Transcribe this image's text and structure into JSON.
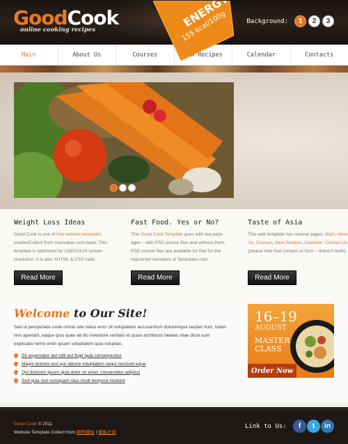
{
  "logo": {
    "part1": "Good",
    "part2": "Cook",
    "tagline": "online cooking recipes"
  },
  "background_switch": {
    "label": "Background:",
    "options": [
      "1",
      "2",
      "3"
    ],
    "active": "1"
  },
  "nav": {
    "items": [
      "Main",
      "About Us",
      "Courses",
      "New Recipes",
      "Calendar",
      "Contacts"
    ],
    "active": "Main"
  },
  "slider": {
    "badge_line1": "ENERGY",
    "badge_line2": "155 kcal/100g",
    "slide_count": 3,
    "current_slide": 1
  },
  "columns": [
    {
      "title": "Weight Loss Ideas",
      "text_pre": "Good Cook is one of ",
      "text_link": "free website templates",
      "text_post": " createdCollect from cssmoban.com team. This template is optimized for 1280X1024 screen resolution. It is also XHTML & CSS valid.",
      "button": "Read More"
    },
    {
      "title": "Fast Food. Yes or No?",
      "text_pre": "This ",
      "text_link": "Good Cook Template",
      "text_post": " goes with two pack ages – with PSD source files and without them. PSD source files are available for free for the registered members of Templates.com.",
      "button": "Read More"
    },
    {
      "title": "Taste of Asia",
      "text_pre": "This web template has several pages: ",
      "links": [
        "Main",
        "About Us",
        "Courses",
        "New Recipes",
        "Calendar",
        "Contact Us"
      ],
      "text_post": " (please note that contact us form – doesn't work).",
      "button": "Read More"
    }
  ],
  "welcome": {
    "title_part1": "Welcome",
    "title_part2": " to Our Site!",
    "text": "Sed ut perspiciatis unde omnis iste natus error sit voluptatem accusantium doloremque laudan tium, totam rem aperiam, eaque ipsa quae ab illo inventore veritatis et quasi architecto beatae vitae dicta sunt explicabo nemo enim ipsam voluptatem quia voluptas.",
    "list": [
      "Sit aspernatur aut odit aut fugit quia consequuntur",
      "Magni dolores eos qui ratione voluptatem sequi nesciunt eque",
      "Qui dolorem ipsum quia dolor sit amet, consectetur adipisci",
      "Sed quia non numquam eius modi tempora incidunt"
    ]
  },
  "promo": {
    "dates": "16–19",
    "month": "AUGUST",
    "title_line1": "MASTER",
    "title_line2": "CLASS",
    "cta": "Order Now"
  },
  "footer": {
    "brand": "Good Cook",
    "year": "© 2011",
    "collect_text": "Website Template Collect from ",
    "link1": "网页模板",
    "separator": " | ",
    "link2": "模板之家",
    "link_us": "Link to Us:",
    "social": [
      "facebook-icon",
      "twitter-icon",
      "linkedin-icon"
    ]
  },
  "colors": {
    "accent": "#e8731f",
    "dark": "#1d1816",
    "text": "#555555"
  }
}
